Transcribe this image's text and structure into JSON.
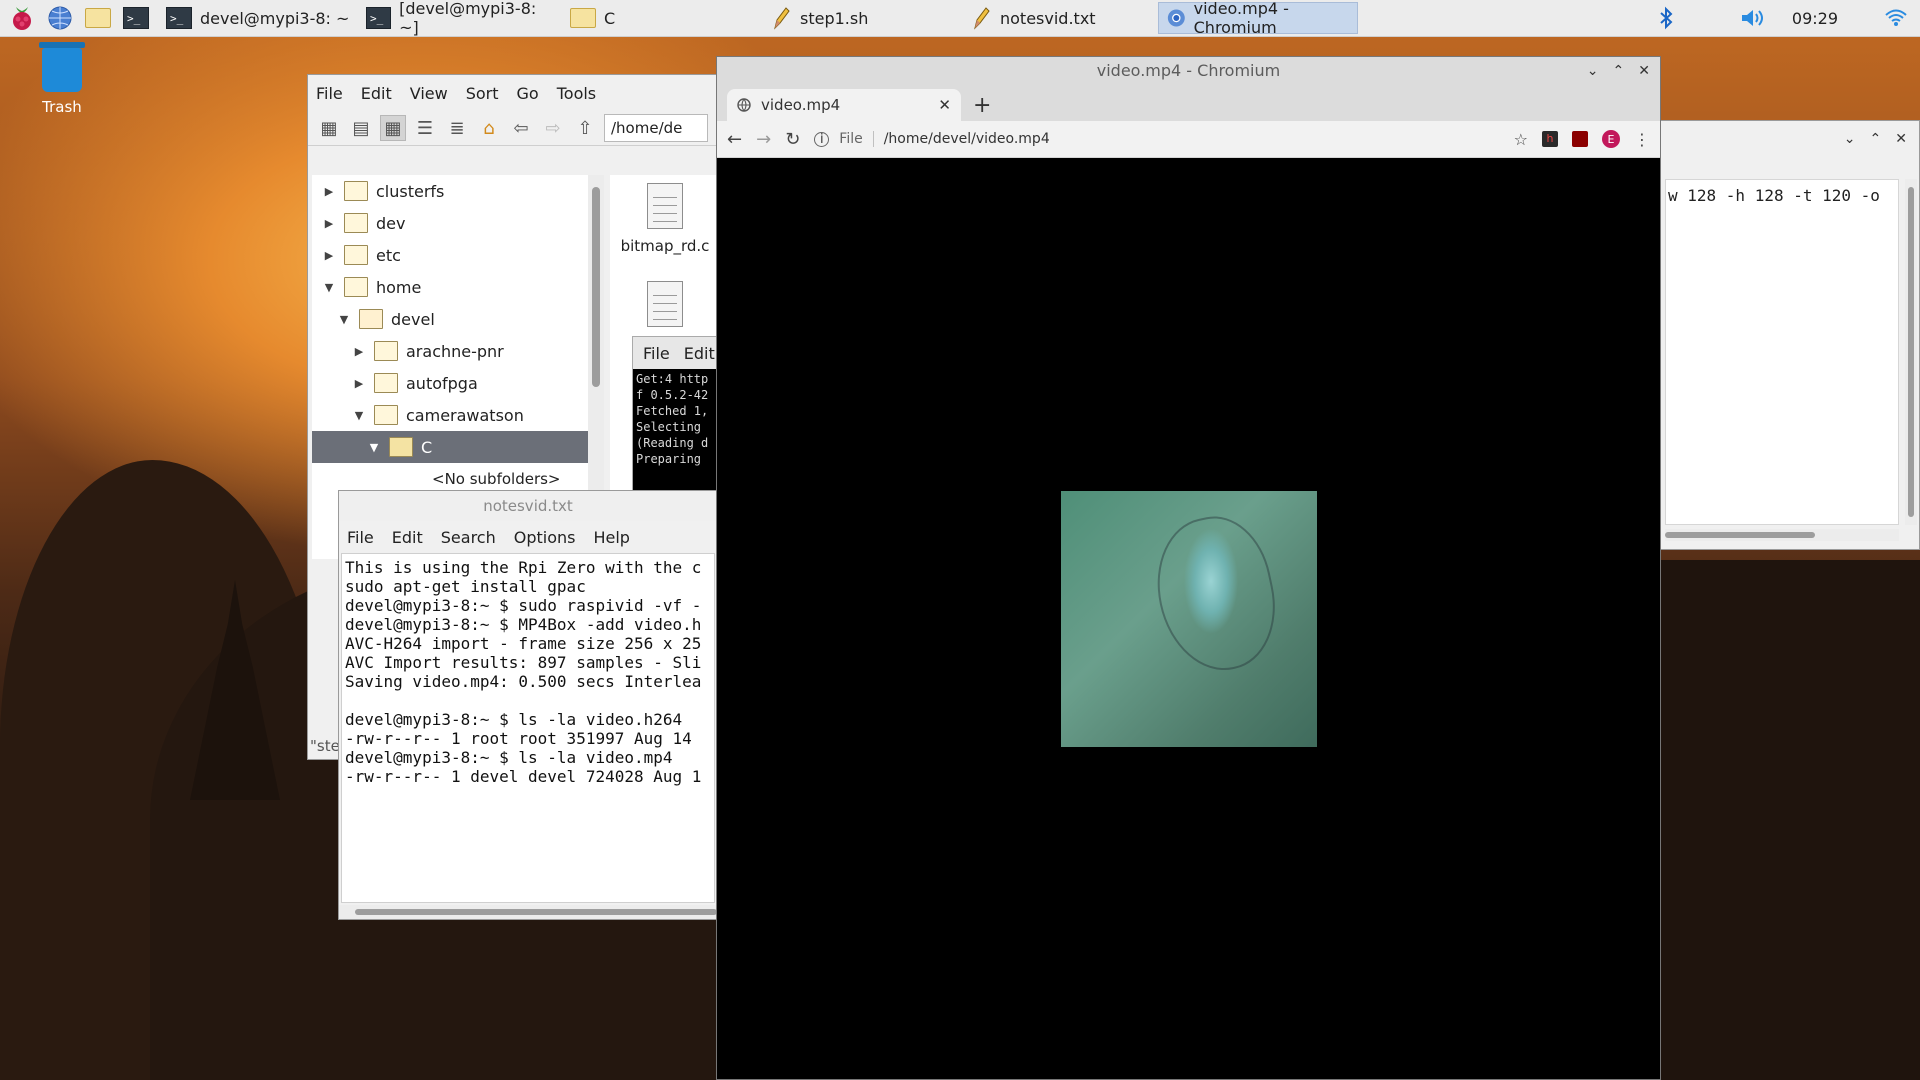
{
  "taskbar": {
    "tasks": [
      {
        "label": "devel@mypi3-8: ~",
        "icon": "terminal-icon"
      },
      {
        "label": "[devel@mypi3-8: ~]",
        "icon": "terminal-icon"
      },
      {
        "label": "C",
        "icon": "folder-icon"
      },
      {
        "label": "step1.sh",
        "icon": "pencil-icon"
      },
      {
        "label": "notesvid.txt",
        "icon": "pencil-icon"
      },
      {
        "label": "video.mp4 - Chromium",
        "icon": "chromium-icon",
        "active": true
      }
    ],
    "clock": "09:29",
    "colors": {
      "bar": "#ececec",
      "active_task": "#c7d7ec"
    }
  },
  "desktop": {
    "trash_label": "Trash"
  },
  "file_manager": {
    "menu": [
      "File",
      "Edit",
      "View",
      "Sort",
      "Go",
      "Tools"
    ],
    "address": "/home/de",
    "tree": [
      {
        "label": "clusterfs",
        "arrow": "▶"
      },
      {
        "label": "dev",
        "arrow": "▶"
      },
      {
        "label": "etc",
        "arrow": "▶"
      },
      {
        "label": "home",
        "arrow": "▼"
      },
      {
        "label": "devel",
        "arrow": "▼"
      },
      {
        "label": "arachne-pnr",
        "arrow": "▶"
      },
      {
        "label": "autofpga",
        "arrow": "▶"
      },
      {
        "label": "camerawatson",
        "arrow": "▼"
      },
      {
        "label": "C",
        "arrow": "▼",
        "selected": true
      }
    ],
    "no_subfolders": "<No subfolders>",
    "files": [
      "bitmap_rd.c"
    ],
    "status": "\"step"
  },
  "small_terminal": {
    "menu": [
      "File",
      "Edit"
    ],
    "lines": [
      "Get:4 http",
      "f 0.5.2-42",
      "Fetched 1,",
      "Selecting ",
      "(Reading d",
      "Preparing "
    ]
  },
  "notes": {
    "title": "notesvid.txt",
    "menu": [
      "File",
      "Edit",
      "Search",
      "Options",
      "Help"
    ],
    "content": "This is using the Rpi Zero with the c\nsudo apt-get install gpac\ndevel@mypi3-8:~ $ sudo raspivid -vf -\ndevel@mypi3-8:~ $ MP4Box -add video.h\nAVC-H264 import - frame size 256 x 25\nAVC Import results: 897 samples - Sli\nSaving video.mp4: 0.500 secs Interlea\n\ndevel@mypi3-8:~ $ ls -la video.h264\n-rw-r--r-- 1 root root 351997 Aug 14\ndevel@mypi3-8:~ $ ls -la video.mp4\n-rw-r--r-- 1 devel devel 724028 Aug 1"
  },
  "right_terminal": {
    "line": "w 128 -h 128 -t 120 -o"
  },
  "chromium": {
    "window_title": "video.mp4 - Chromium",
    "tab_title": "video.mp4",
    "omnibox_scheme": "File",
    "omnibox_path": "/home/devel/video.mp4",
    "avatar_letter": "E"
  }
}
